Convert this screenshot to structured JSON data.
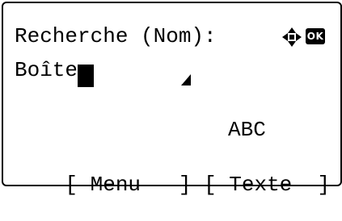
{
  "screen": {
    "title": "Recherche (Nom):",
    "input_value": "Boîte",
    "input_mode": "ABC",
    "icons": {
      "navigation": "four-way-arrow-icon",
      "ok": "ok-icon"
    },
    "ok_label": "OK"
  },
  "softkeys": {
    "left_label": "[ Menu   ]",
    "right_label": "[ Texte  ]"
  }
}
